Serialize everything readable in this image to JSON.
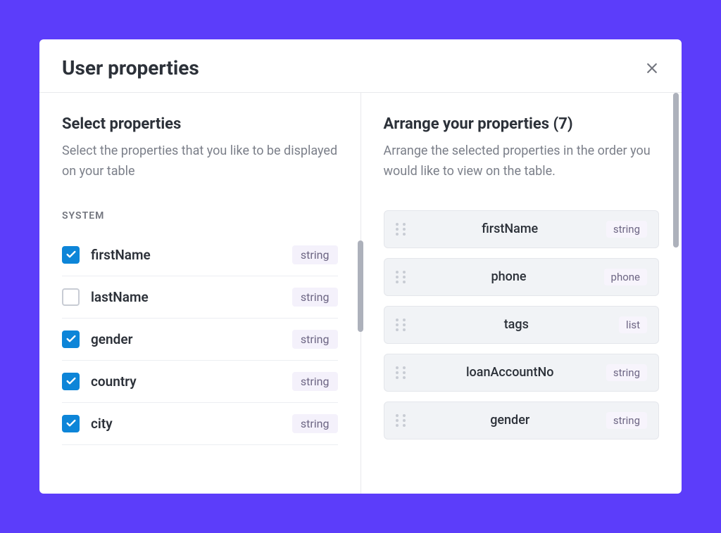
{
  "modal": {
    "title": "User properties"
  },
  "left": {
    "heading": "Select properties",
    "subtext": "Select the properties that you like to be displayed on your table",
    "sectionLabel": "SYSTEM",
    "items": [
      {
        "name": "firstName",
        "type": "string",
        "checked": true
      },
      {
        "name": "lastName",
        "type": "string",
        "checked": false
      },
      {
        "name": "gender",
        "type": "string",
        "checked": true
      },
      {
        "name": "country",
        "type": "string",
        "checked": true
      },
      {
        "name": "city",
        "type": "string",
        "checked": true
      }
    ]
  },
  "right": {
    "heading": "Arrange your properties (7)",
    "subtext": "Arrange the selected properties in the order you would like to view on the table.",
    "items": [
      {
        "name": "firstName",
        "type": "string"
      },
      {
        "name": "phone",
        "type": "phone"
      },
      {
        "name": "tags",
        "type": "list"
      },
      {
        "name": "loanAccountNo",
        "type": "string"
      },
      {
        "name": "gender",
        "type": "string"
      }
    ]
  }
}
